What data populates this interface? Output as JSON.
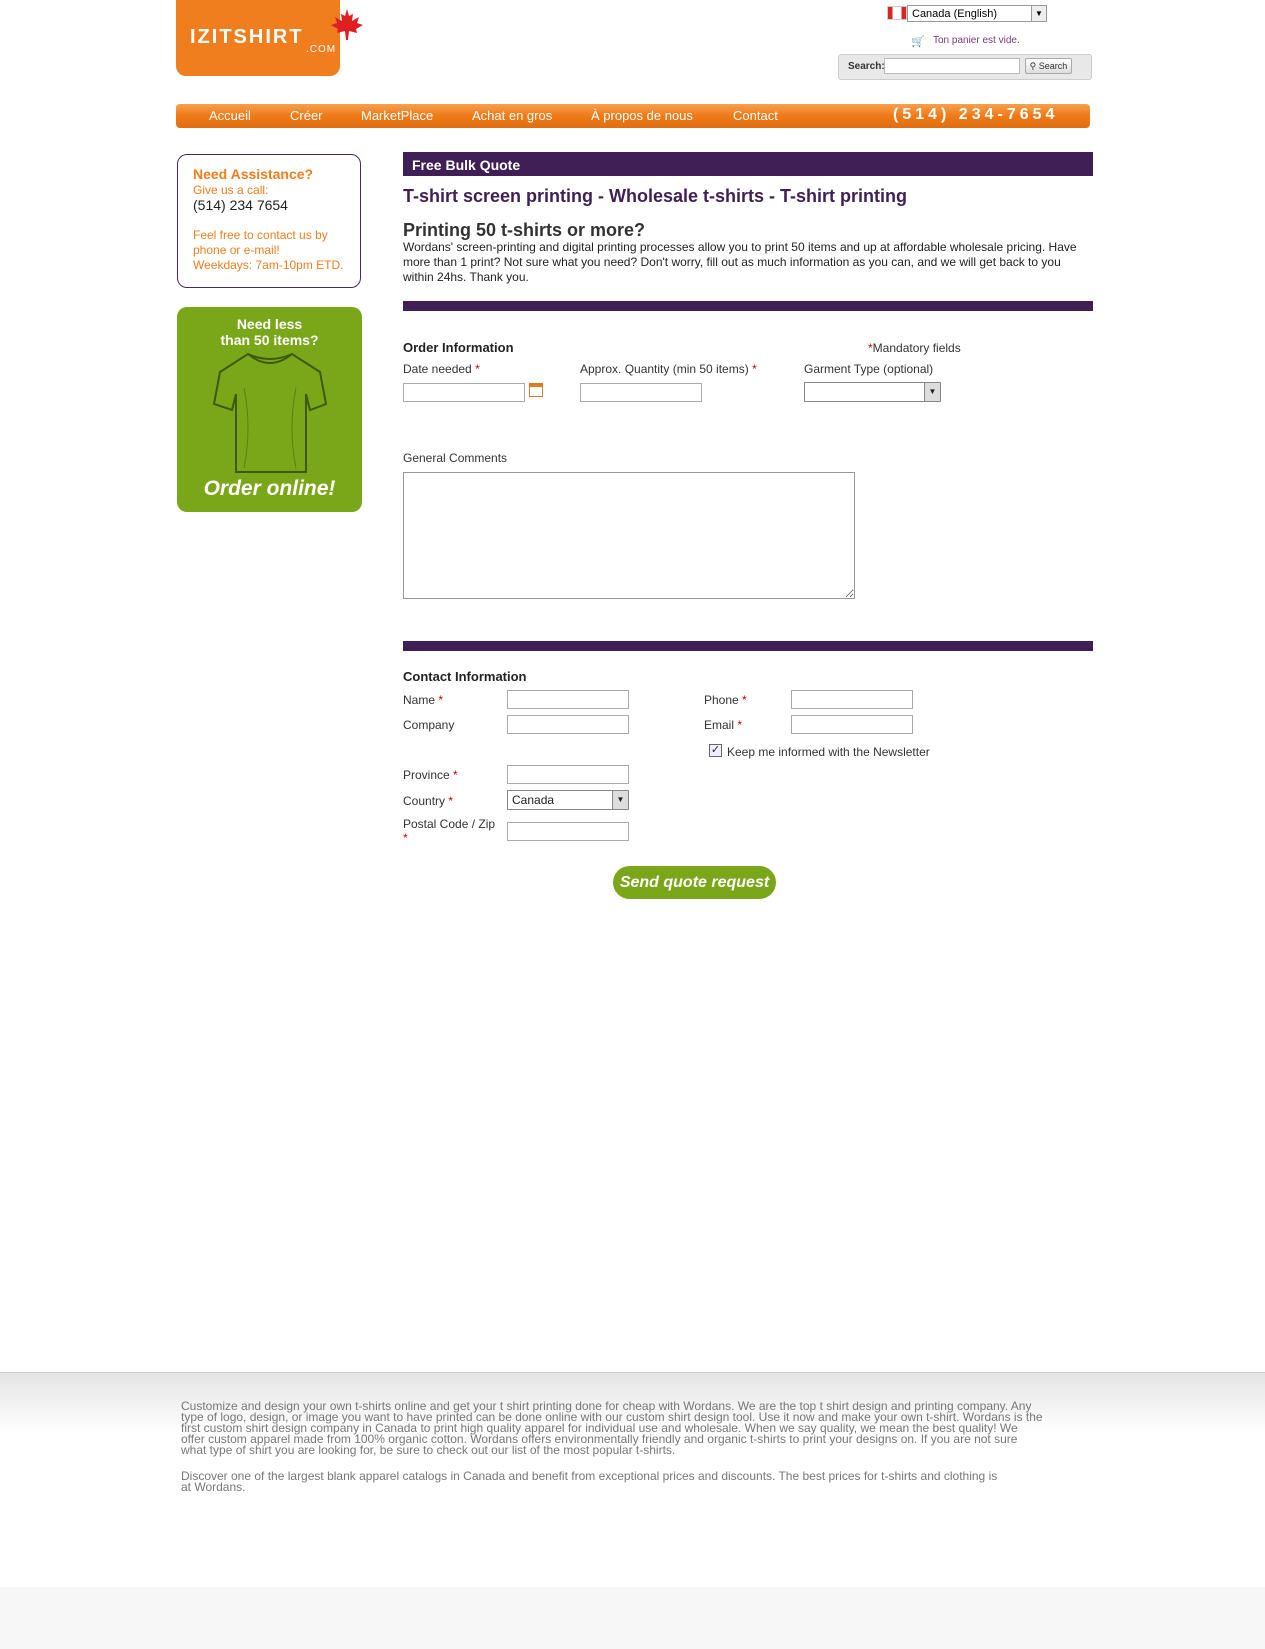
{
  "header": {
    "logo_text": "IZITSHIRT",
    "logo_sub": ".COM",
    "locale": "Canada (English)",
    "cart_text": "Ton panier est vide.",
    "search_label": "Search:",
    "search_value": "",
    "search_button": "Search"
  },
  "nav": {
    "items": [
      "Accueil",
      "Créer",
      "MarketPlace",
      "Achat en gros",
      "À propos de nous",
      "Contact"
    ],
    "phone": "(514) 234-7654"
  },
  "sidebar": {
    "assist_title": "Need Assistance?",
    "assist_call": "Give us a call:",
    "assist_phone": "(514) 234 7654",
    "assist_info_1": "Feel free to contact us by",
    "assist_info_2": "phone or e-mail!",
    "assist_info_3": "Weekdays: 7am-10pm ETD.",
    "promo_line1": "Need less",
    "promo_line2": "than 50 items?",
    "promo_cta": "Order online!"
  },
  "main": {
    "bar_title": "Free Bulk Quote",
    "h1": "T-shirt screen printing - Wholesale t-shirts - T-shirt printing",
    "h2": "Printing 50 t-shirts or more?",
    "intro": "Wordans' screen-printing and digital printing processes allow you to print 50 items and up at affordable wholesale pricing. Have more than 1 print? Not sure what you need? Don't worry, fill out as much information as you can, and we will get back to you within 24hs. Thank you."
  },
  "order": {
    "title": "Order Information",
    "mandatory_star": "*",
    "mandatory_text": "Mandatory fields",
    "date_label": "Date needed",
    "date_value": "",
    "qty_label": "Approx. Quantity (min 50 items)",
    "qty_value": "",
    "garment_label": "Garment Type (optional)",
    "garment_value": "",
    "comments_label": "General Comments",
    "comments_value": ""
  },
  "contact": {
    "title": "Contact Information",
    "name_label": "Name",
    "company_label": "Company",
    "province_label": "Province",
    "country_label": "Country",
    "country_value": "Canada",
    "postal_label": "Postal Code / Zip",
    "phone_label": "Phone",
    "email_label": "Email",
    "newsletter_label": "Keep me informed with the Newsletter",
    "newsletter_checked": true,
    "required_mark": "*",
    "submit_label": "Send quote request"
  },
  "footer": {
    "para1_line1": "Customize and design your own t-shirts online and get your t shirt printing done for cheap with Wordans. We are the top t shirt design and printing company. Any",
    "para1_line2": "type of logo, design, or image you want to have printed can be done online with our custom shirt design tool. Use it now and make your own t-shirt. Wordans is the",
    "para1_line3": " first custom shirt design company in Canada to print high quality apparel for individual use and wholesale. When we say quality, we mean the best quality! We",
    "para1_line4": "offer custom apparel made from 100% organic cotton. Wordans offers environmentally friendly and organic t-shirts to print your designs on. If you are not sure",
    "para1_line5": "what type of shirt you are looking for, be sure to check out our list of the most popular t-shirts.",
    "para2_line1": "Discover one of the largest blank apparel catalogs in Canada and benefit from exceptional prices and discounts. The best prices for t-shirts and clothing is",
    "para2_line2": "at Wordans."
  },
  "colors": {
    "brand_orange": "#f07d1e",
    "brand_purple": "#3f1f55",
    "brand_green": "#7aa71a"
  }
}
